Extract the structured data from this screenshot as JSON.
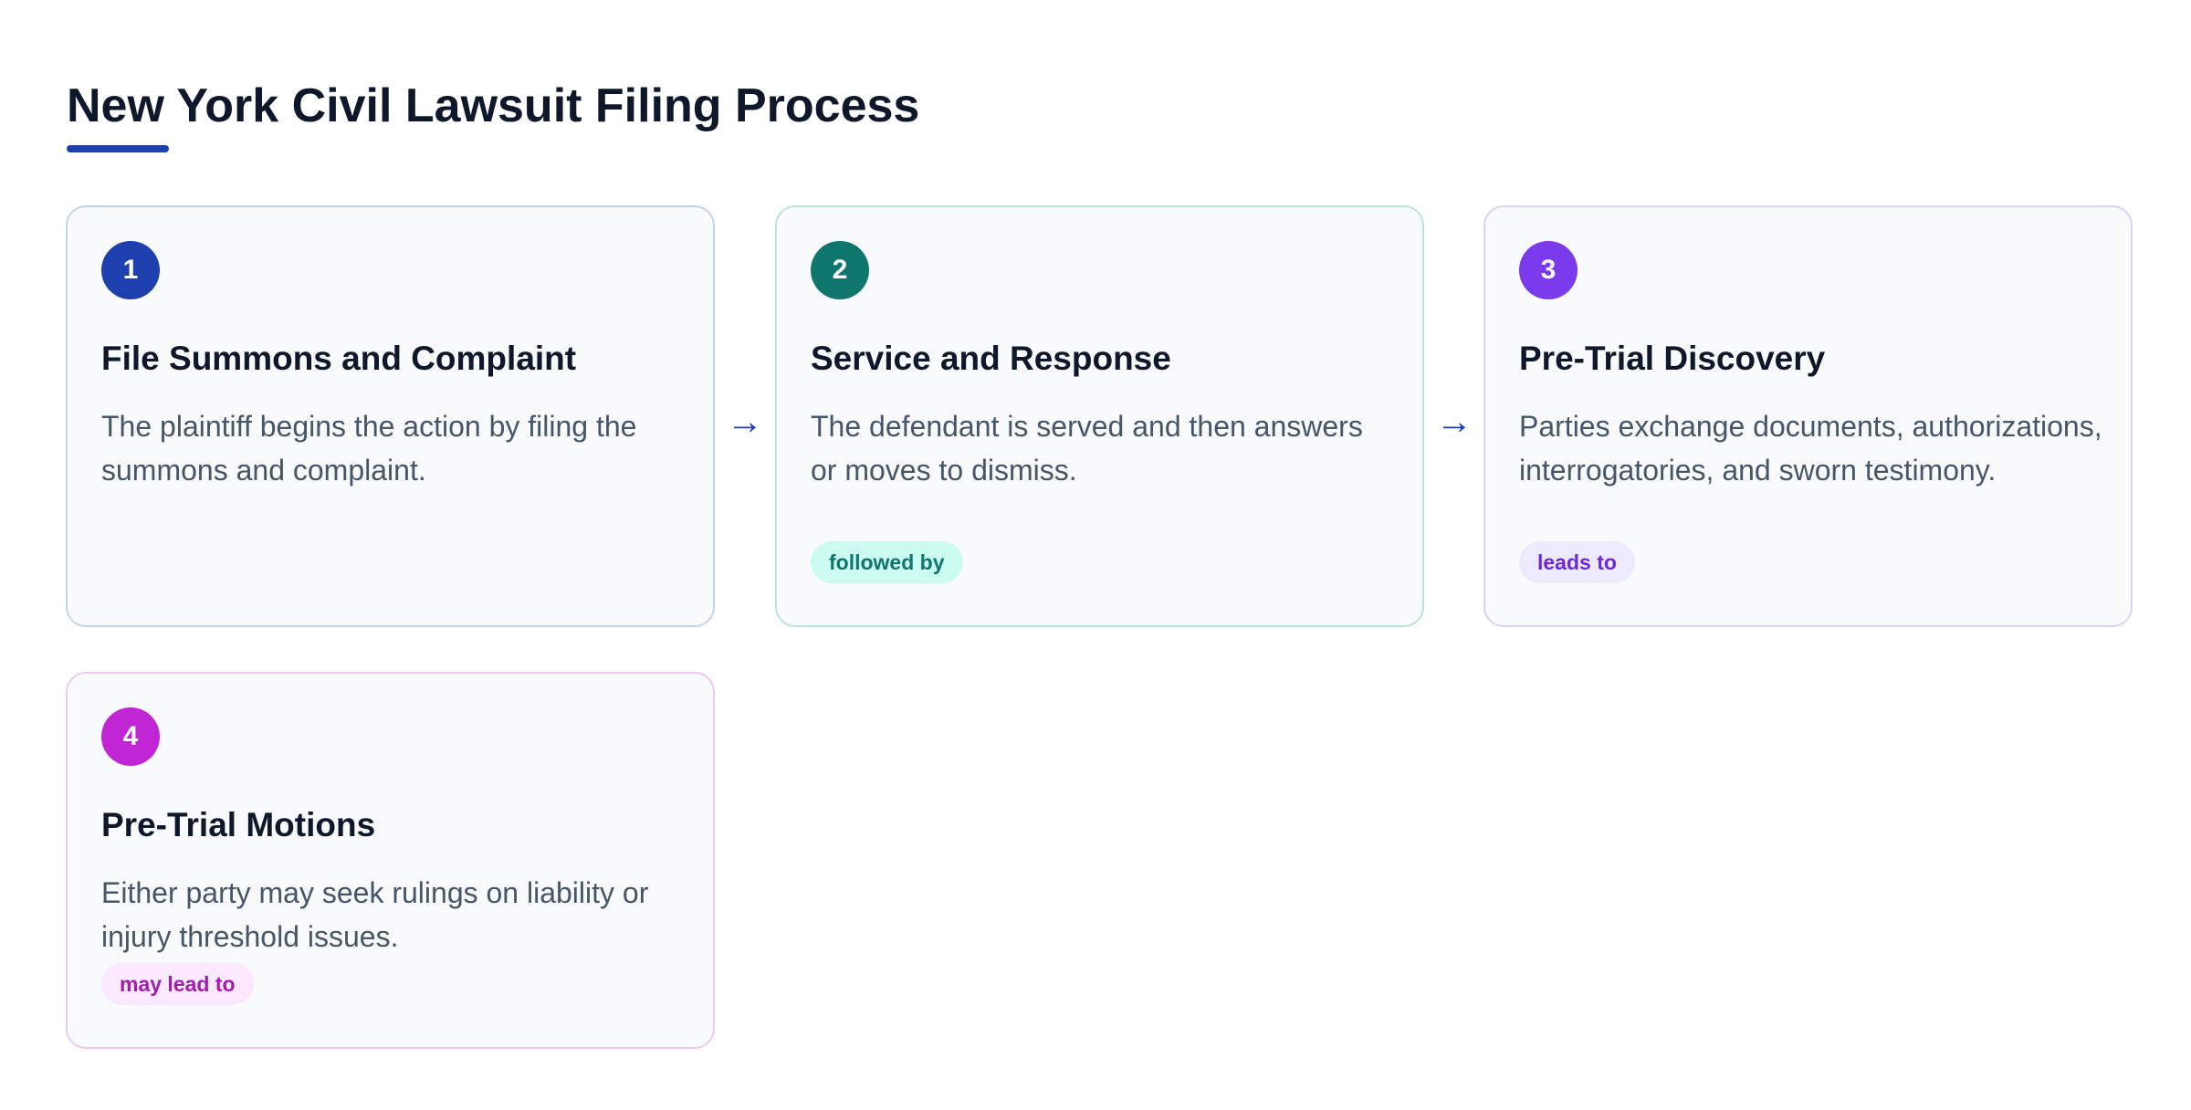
{
  "title": "New York Civil Lawsuit Filing Process",
  "colors": {
    "accent": "#1e40af",
    "step1": "#1e40af",
    "step2": "#0f766e",
    "step3": "#7c3aed",
    "step4": "#c026d3"
  },
  "arrow_icon": "→",
  "steps": [
    {
      "number": "1",
      "title": "File Summons and Complaint",
      "description": "The plaintiff begins the action by filing the summons and complaint."
    },
    {
      "number": "2",
      "title": "Service and Response",
      "description": "The defendant is served and then answers or moves to dismiss.",
      "badge": "followed by"
    },
    {
      "number": "3",
      "title": "Pre-Trial Discovery",
      "description": "Parties exchange documents, authorizations, interrogatories, and sworn testimony.",
      "badge": "leads to"
    },
    {
      "number": "4",
      "title": "Pre-Trial Motions",
      "description": "Either party may seek rulings on liability or injury threshold issues.",
      "badge": "may lead to"
    }
  ]
}
